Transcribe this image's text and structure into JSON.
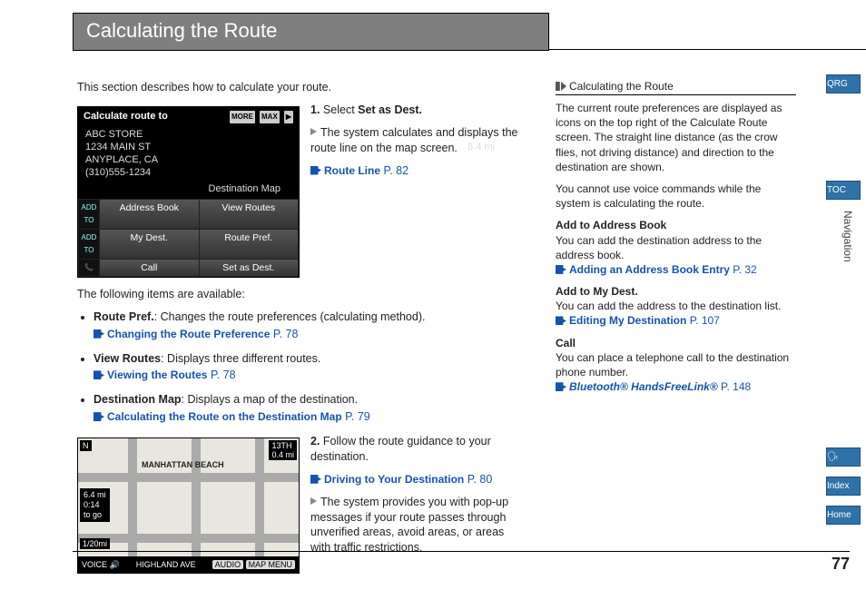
{
  "header": {
    "title": "Calculating the Route"
  },
  "page_number": "77",
  "left": {
    "intro": "This section describes how to calculate your route.",
    "fig1": {
      "title": "Calculate route to",
      "icons": [
        "MORE",
        "MAX",
        "▶"
      ],
      "address": [
        "ABC STORE",
        "1234 MAIN ST",
        "ANYPLACE, CA",
        "(310)555-1234"
      ],
      "distance": "8.4 mi",
      "dest_map": "Destination Map",
      "rows": [
        {
          "tag": "ADD TO",
          "c1": "Address Book",
          "c2": "View Routes"
        },
        {
          "tag": "ADD TO",
          "c1": "My Dest.",
          "c2": "Route Pref."
        },
        {
          "tag": "📞",
          "c1": "Call",
          "c2": "Set as Dest."
        }
      ]
    },
    "step1": {
      "num": "1.",
      "text_a": "Select ",
      "text_b": "Set as Dest.",
      "sub1": "The system calculates and displays the route line on the map screen.",
      "xref_label": "Route Line",
      "xref_page": "P. 82"
    },
    "available_intro": "The following items are available:",
    "bullets": [
      {
        "term": "Route Pref.",
        "rest": ": Changes the route preferences (calculating method).",
        "xref_label": "Changing the Route Preference",
        "xref_page": "P. 78"
      },
      {
        "term": "View Routes",
        "rest": ": Displays three different routes.",
        "xref_label": "Viewing the Routes",
        "xref_page": "P. 78"
      },
      {
        "term": "Destination Map",
        "rest": ": Displays a map of the destination.",
        "xref_label": "Calculating the Route on the Destination Map",
        "xref_page": "P. 79"
      }
    ],
    "fig2": {
      "tl": "N",
      "tr_a": "13TH",
      "tr_b": "0.4 mi",
      "lbox": [
        "6.4 mi",
        "0:14",
        "to go"
      ],
      "scale": "1/20mi",
      "mlabel": "MANHATTAN BEACH",
      "bar_left": "VOICE 🔊",
      "bar_mid": "HIGHLAND AVE",
      "bar_r1": "AUDIO",
      "bar_r2": "MAP MENU"
    },
    "step2": {
      "num": "2.",
      "text": "Follow the route guidance to your destination.",
      "xref_label": "Driving to Your Destination",
      "xref_page": "P. 80",
      "sub": "The system provides you with pop-up messages if your route passes through unverified areas, avoid areas, or areas with traffic restrictions."
    }
  },
  "right": {
    "title": "Calculating the Route",
    "p1": "The current route preferences are displayed as icons on the top right of the Calculate Route screen. The straight line distance (as the crow flies, not driving distance) and direction to the destination are shown.",
    "p2": "You cannot use voice commands while the system is calculating the route.",
    "items": [
      {
        "h": "Add to Address Book",
        "t": "You can add the destination address to the address book.",
        "xl": "Adding an Address Book Entry",
        "xp": "P. 32"
      },
      {
        "h": "Add to My Dest.",
        "t": "You can add the address to the destination list.",
        "xl": "Editing My Destination",
        "xp": "P. 107"
      },
      {
        "h": "Call",
        "t": "You can place a telephone call to the destination phone number.",
        "xl": "Bluetooth® HandsFreeLink®",
        "xp": "P. 148",
        "italic": true
      }
    ]
  },
  "edge": {
    "qrg": "QRG",
    "toc": "TOC",
    "nav": "Navigation",
    "voice": "🗣",
    "index": "Index",
    "home": "Home"
  }
}
